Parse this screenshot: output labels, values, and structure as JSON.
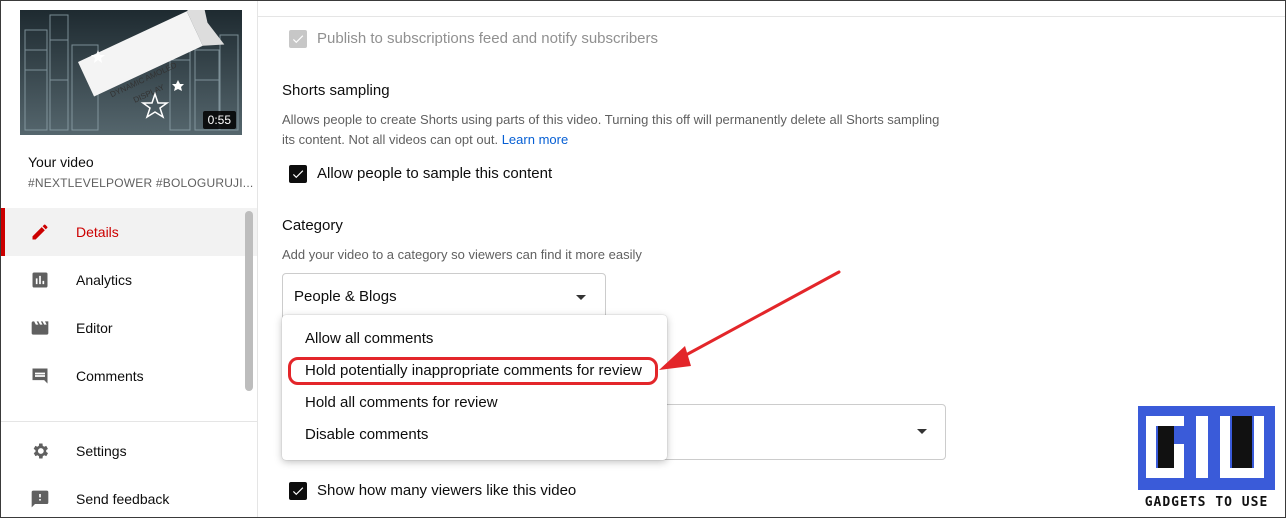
{
  "sidebar": {
    "thumbnail": {
      "duration": "0:55",
      "banner_text": [
        "DYNAMIC AMOLED",
        "DISPLAY"
      ]
    },
    "your_video_label": "Your video",
    "video_tags": "#NEXTLEVELPOWER #BOLOGURUJI...",
    "nav_items": [
      {
        "label": "Details",
        "icon": "pencil-icon",
        "active": true
      },
      {
        "label": "Analytics",
        "icon": "analytics-icon",
        "active": false
      },
      {
        "label": "Editor",
        "icon": "clapperboard-icon",
        "active": false
      },
      {
        "label": "Comments",
        "icon": "comment-icon",
        "active": false
      }
    ],
    "bottom_items": [
      {
        "label": "Settings",
        "icon": "gear-icon"
      },
      {
        "label": "Send feedback",
        "icon": "feedback-icon"
      }
    ]
  },
  "main": {
    "publish_checkbox": {
      "label": "Publish to subscriptions feed and notify subscribers",
      "checked": true,
      "disabled": true
    },
    "shorts": {
      "title": "Shorts sampling",
      "description": "Allows people to create Shorts using parts of this video. Turning this off will permanently delete all Shorts sampling its content. Not all videos can opt out.",
      "learn_more": "Learn more",
      "checkbox_label": "Allow people to sample this content"
    },
    "category": {
      "title": "Category",
      "description": "Add your video to a category so viewers can find it more easily",
      "selected": "People & Blogs"
    },
    "comments_dropdown": {
      "options": [
        "Allow all comments",
        "Hold potentially inappropriate comments for review",
        "Hold all comments for review",
        "Disable comments"
      ],
      "highlighted_index": 1
    },
    "likes_checkbox": {
      "label": "Show how many viewers like this video",
      "checked": true
    }
  },
  "watermark": {
    "text": "GADGETS TO USE",
    "accent": "#3a5bd9"
  },
  "colors": {
    "active": "#cc0000",
    "link": "#065fd4",
    "highlight": "#e3262a"
  }
}
